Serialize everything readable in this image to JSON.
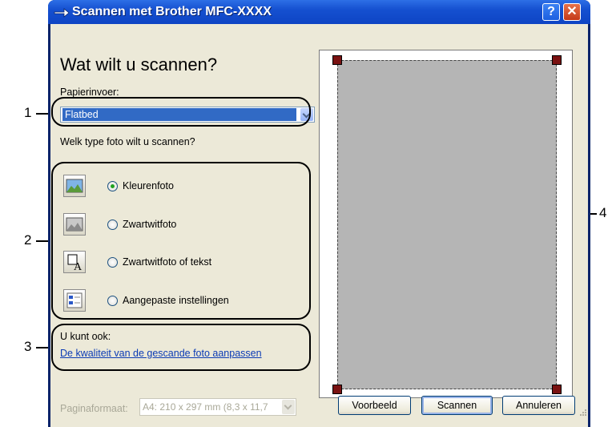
{
  "window": {
    "title": "Scannen met Brother MFC-",
    "title_model": "XXXX",
    "help_label": "?",
    "close_label": "✕"
  },
  "heading": "Wat wilt u scannen?",
  "paper_source": {
    "label": "Papierinvoer:",
    "value": "Flatbed"
  },
  "photo_type_question": "Welk type foto wilt u scannen?",
  "options": [
    {
      "label": "Kleurenfoto",
      "icon": "color-photo-icon",
      "selected": true
    },
    {
      "label": "Zwartwitfoto",
      "icon": "grayscale-photo-icon",
      "selected": false
    },
    {
      "label": "Zwartwitfoto of tekst",
      "icon": "bw-text-icon",
      "selected": false
    },
    {
      "label": "Aangepaste instellingen",
      "icon": "custom-settings-icon",
      "selected": false
    }
  ],
  "also_label": "U kunt ook:",
  "adjust_link": "De kwaliteit van de gescande foto aanpassen",
  "page_format": {
    "label": "Paginaformaat:",
    "value": "A4: 210 x 297 mm (8,3 x 11,7"
  },
  "buttons": {
    "preview": "Voorbeeld",
    "scan": "Scannen",
    "cancel": "Annuleren"
  },
  "callouts": [
    "1",
    "2",
    "3",
    "4"
  ],
  "colors": {
    "titlebar": "#0e44c4",
    "selection": "#316ac5",
    "preview_area": "#b5b5b5",
    "handle": "#7a1212"
  }
}
